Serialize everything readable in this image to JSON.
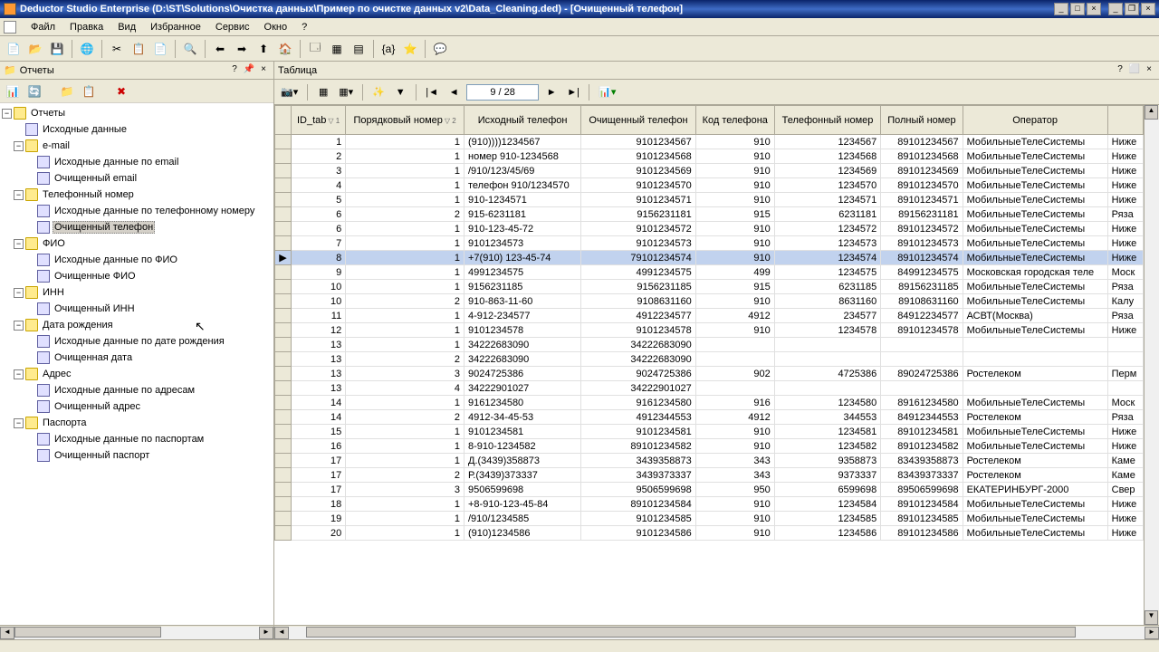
{
  "title": "Deductor Studio Enterprise (D:\\ST\\Solutions\\Очистка данных\\Пример по очистке данных v2\\Data_Cleaning.ded) - [Очищенный телефон]",
  "menu": [
    "Файл",
    "Правка",
    "Вид",
    "Избранное",
    "Сервис",
    "Окно",
    "?"
  ],
  "sidebar": {
    "title": "Отчеты",
    "tree": {
      "root": "Отчеты",
      "nodes": [
        {
          "label": "Исходные данные",
          "type": "report",
          "depth": 1
        },
        {
          "label": "e-mail",
          "type": "folder",
          "depth": 1,
          "expanded": true
        },
        {
          "label": "Исходные данные по email",
          "type": "report",
          "depth": 2
        },
        {
          "label": "Очищенный email",
          "type": "report",
          "depth": 2
        },
        {
          "label": "Телефонный номер",
          "type": "folder",
          "depth": 1,
          "expanded": true
        },
        {
          "label": "Исходные данные по телефонному номеру",
          "type": "report",
          "depth": 2
        },
        {
          "label": "Очищенный телефон",
          "type": "report",
          "depth": 2,
          "selected": true
        },
        {
          "label": "ФИО",
          "type": "folder",
          "depth": 1,
          "expanded": true
        },
        {
          "label": "Исходные данные по ФИО",
          "type": "report",
          "depth": 2
        },
        {
          "label": "Очищенные ФИО",
          "type": "report",
          "depth": 2
        },
        {
          "label": "ИНН",
          "type": "folder",
          "depth": 1,
          "expanded": true
        },
        {
          "label": "Очищенный ИНН",
          "type": "report",
          "depth": 2
        },
        {
          "label": "Дата рождения",
          "type": "folder",
          "depth": 1,
          "expanded": true
        },
        {
          "label": "Исходные данные по дате рождения",
          "type": "report",
          "depth": 2
        },
        {
          "label": "Очищенная дата",
          "type": "report",
          "depth": 2
        },
        {
          "label": "Адрес",
          "type": "folder",
          "depth": 1,
          "expanded": true
        },
        {
          "label": "Исходные данные по адресам",
          "type": "report",
          "depth": 2
        },
        {
          "label": "Очищенный адрес",
          "type": "report",
          "depth": 2
        },
        {
          "label": "Паспорта",
          "type": "folder",
          "depth": 1,
          "expanded": true
        },
        {
          "label": "Исходные данные по паспортам",
          "type": "report",
          "depth": 2
        },
        {
          "label": "Очищенный паспорт",
          "type": "report",
          "depth": 2
        }
      ]
    }
  },
  "main": {
    "title": "Таблица",
    "record": "9 / 28",
    "columns": [
      "ID_tab",
      "Порядковый номер",
      "Исходный телефон",
      "Очищенный телефон",
      "Код телефона",
      "Телефонный номер",
      "Полный номер",
      "Оператор",
      ""
    ],
    "sort1": "▽ 1",
    "sort2": "▽ 2",
    "rows": [
      {
        "c": [
          "1",
          "1",
          "(910))))1234567",
          "9101234567",
          "910",
          "1234567",
          "89101234567",
          "МобильныеТелеСистемы",
          "Ниже"
        ]
      },
      {
        "c": [
          "2",
          "1",
          "номер 910-1234568",
          "9101234568",
          "910",
          "1234568",
          "89101234568",
          "МобильныеТелеСистемы",
          "Ниже"
        ]
      },
      {
        "c": [
          "3",
          "1",
          "/910/123/45/69",
          "9101234569",
          "910",
          "1234569",
          "89101234569",
          "МобильныеТелеСистемы",
          "Ниже"
        ]
      },
      {
        "c": [
          "4",
          "1",
          "телефон 910/1234570",
          "9101234570",
          "910",
          "1234570",
          "89101234570",
          "МобильныеТелеСистемы",
          "Ниже"
        ]
      },
      {
        "c": [
          "5",
          "1",
          "910-1234571",
          "9101234571",
          "910",
          "1234571",
          "89101234571",
          "МобильныеТелеСистемы",
          "Ниже"
        ]
      },
      {
        "c": [
          "6",
          "2",
          "915-6231181",
          "9156231181",
          "915",
          "6231181",
          "89156231181",
          "МобильныеТелеСистемы",
          "Ряза"
        ]
      },
      {
        "c": [
          "6",
          "1",
          "910-123-45-72",
          "9101234572",
          "910",
          "1234572",
          "89101234572",
          "МобильныеТелеСистемы",
          "Ниже"
        ]
      },
      {
        "c": [
          "7",
          "1",
          "9101234573",
          "9101234573",
          "910",
          "1234573",
          "89101234573",
          "МобильныеТелеСистемы",
          "Ниже"
        ]
      },
      {
        "c": [
          "8",
          "1",
          "+7(910) 123-45-74",
          "79101234574",
          "910",
          "1234574",
          "89101234574",
          "МобильныеТелеСистемы",
          "Ниже"
        ],
        "sel": true,
        "cur": true
      },
      {
        "c": [
          "9",
          "1",
          "4991234575",
          "4991234575",
          "499",
          "1234575",
          "84991234575",
          "Московская городская теле",
          "Моск"
        ]
      },
      {
        "c": [
          "10",
          "1",
          "9156231185",
          "9156231185",
          "915",
          "6231185",
          "89156231185",
          "МобильныеТелеСистемы",
          "Ряза"
        ]
      },
      {
        "c": [
          "10",
          "2",
          "910-863-11-60",
          "9108631160",
          "910",
          "8631160",
          "89108631160",
          "МобильныеТелеСистемы",
          "Калу"
        ]
      },
      {
        "c": [
          "11",
          "1",
          "4-912-234577",
          "4912234577",
          "4912",
          "234577",
          "84912234577",
          "АСВТ(Москва)",
          "Ряза"
        ]
      },
      {
        "c": [
          "12",
          "1",
          "9101234578",
          "9101234578",
          "910",
          "1234578",
          "89101234578",
          "МобильныеТелеСистемы",
          "Ниже"
        ]
      },
      {
        "c": [
          "13",
          "1",
          "34222683090",
          "34222683090",
          "",
          "",
          "",
          "",
          ""
        ]
      },
      {
        "c": [
          "13",
          "2",
          "34222683090",
          "34222683090",
          "",
          "",
          "",
          "",
          ""
        ]
      },
      {
        "c": [
          "13",
          "3",
          "9024725386",
          "9024725386",
          "902",
          "4725386",
          "89024725386",
          "Ростелеком",
          "Перм"
        ]
      },
      {
        "c": [
          "13",
          "4",
          "34222901027",
          "34222901027",
          "",
          "",
          "",
          "",
          ""
        ]
      },
      {
        "c": [
          "14",
          "1",
          "9161234580",
          "9161234580",
          "916",
          "1234580",
          "89161234580",
          "МобильныеТелеСистемы",
          "Моск"
        ]
      },
      {
        "c": [
          "14",
          "2",
          "4912-34-45-53",
          "4912344553",
          "4912",
          "344553",
          "84912344553",
          "Ростелеком",
          "Ряза"
        ]
      },
      {
        "c": [
          "15",
          "1",
          "9101234581",
          "9101234581",
          "910",
          "1234581",
          "89101234581",
          "МобильныеТелеСистемы",
          "Ниже"
        ]
      },
      {
        "c": [
          "16",
          "1",
          "8-910-1234582",
          "89101234582",
          "910",
          "1234582",
          "89101234582",
          "МобильныеТелеСистемы",
          "Ниже"
        ]
      },
      {
        "c": [
          "17",
          "1",
          "Д.(3439)358873",
          "3439358873",
          "343",
          "9358873",
          "83439358873",
          "Ростелеком",
          "Каме"
        ]
      },
      {
        "c": [
          "17",
          "2",
          "Р.(3439)373337",
          "3439373337",
          "343",
          "9373337",
          "83439373337",
          "Ростелеком",
          "Каме"
        ]
      },
      {
        "c": [
          "17",
          "3",
          "9506599698",
          "9506599698",
          "950",
          "6599698",
          "89506599698",
          "ЕКАТЕРИНБУРГ-2000",
          "Свер"
        ]
      },
      {
        "c": [
          "18",
          "1",
          "+8-910-123-45-84",
          "89101234584",
          "910",
          "1234584",
          "89101234584",
          "МобильныеТелеСистемы",
          "Ниже"
        ]
      },
      {
        "c": [
          "19",
          "1",
          "/910/1234585",
          "9101234585",
          "910",
          "1234585",
          "89101234585",
          "МобильныеТелеСистемы",
          "Ниже"
        ]
      },
      {
        "c": [
          "20",
          "1",
          "(910)1234586",
          "9101234586",
          "910",
          "1234586",
          "89101234586",
          "МобильныеТелеСистемы",
          "Ниже"
        ]
      }
    ]
  }
}
